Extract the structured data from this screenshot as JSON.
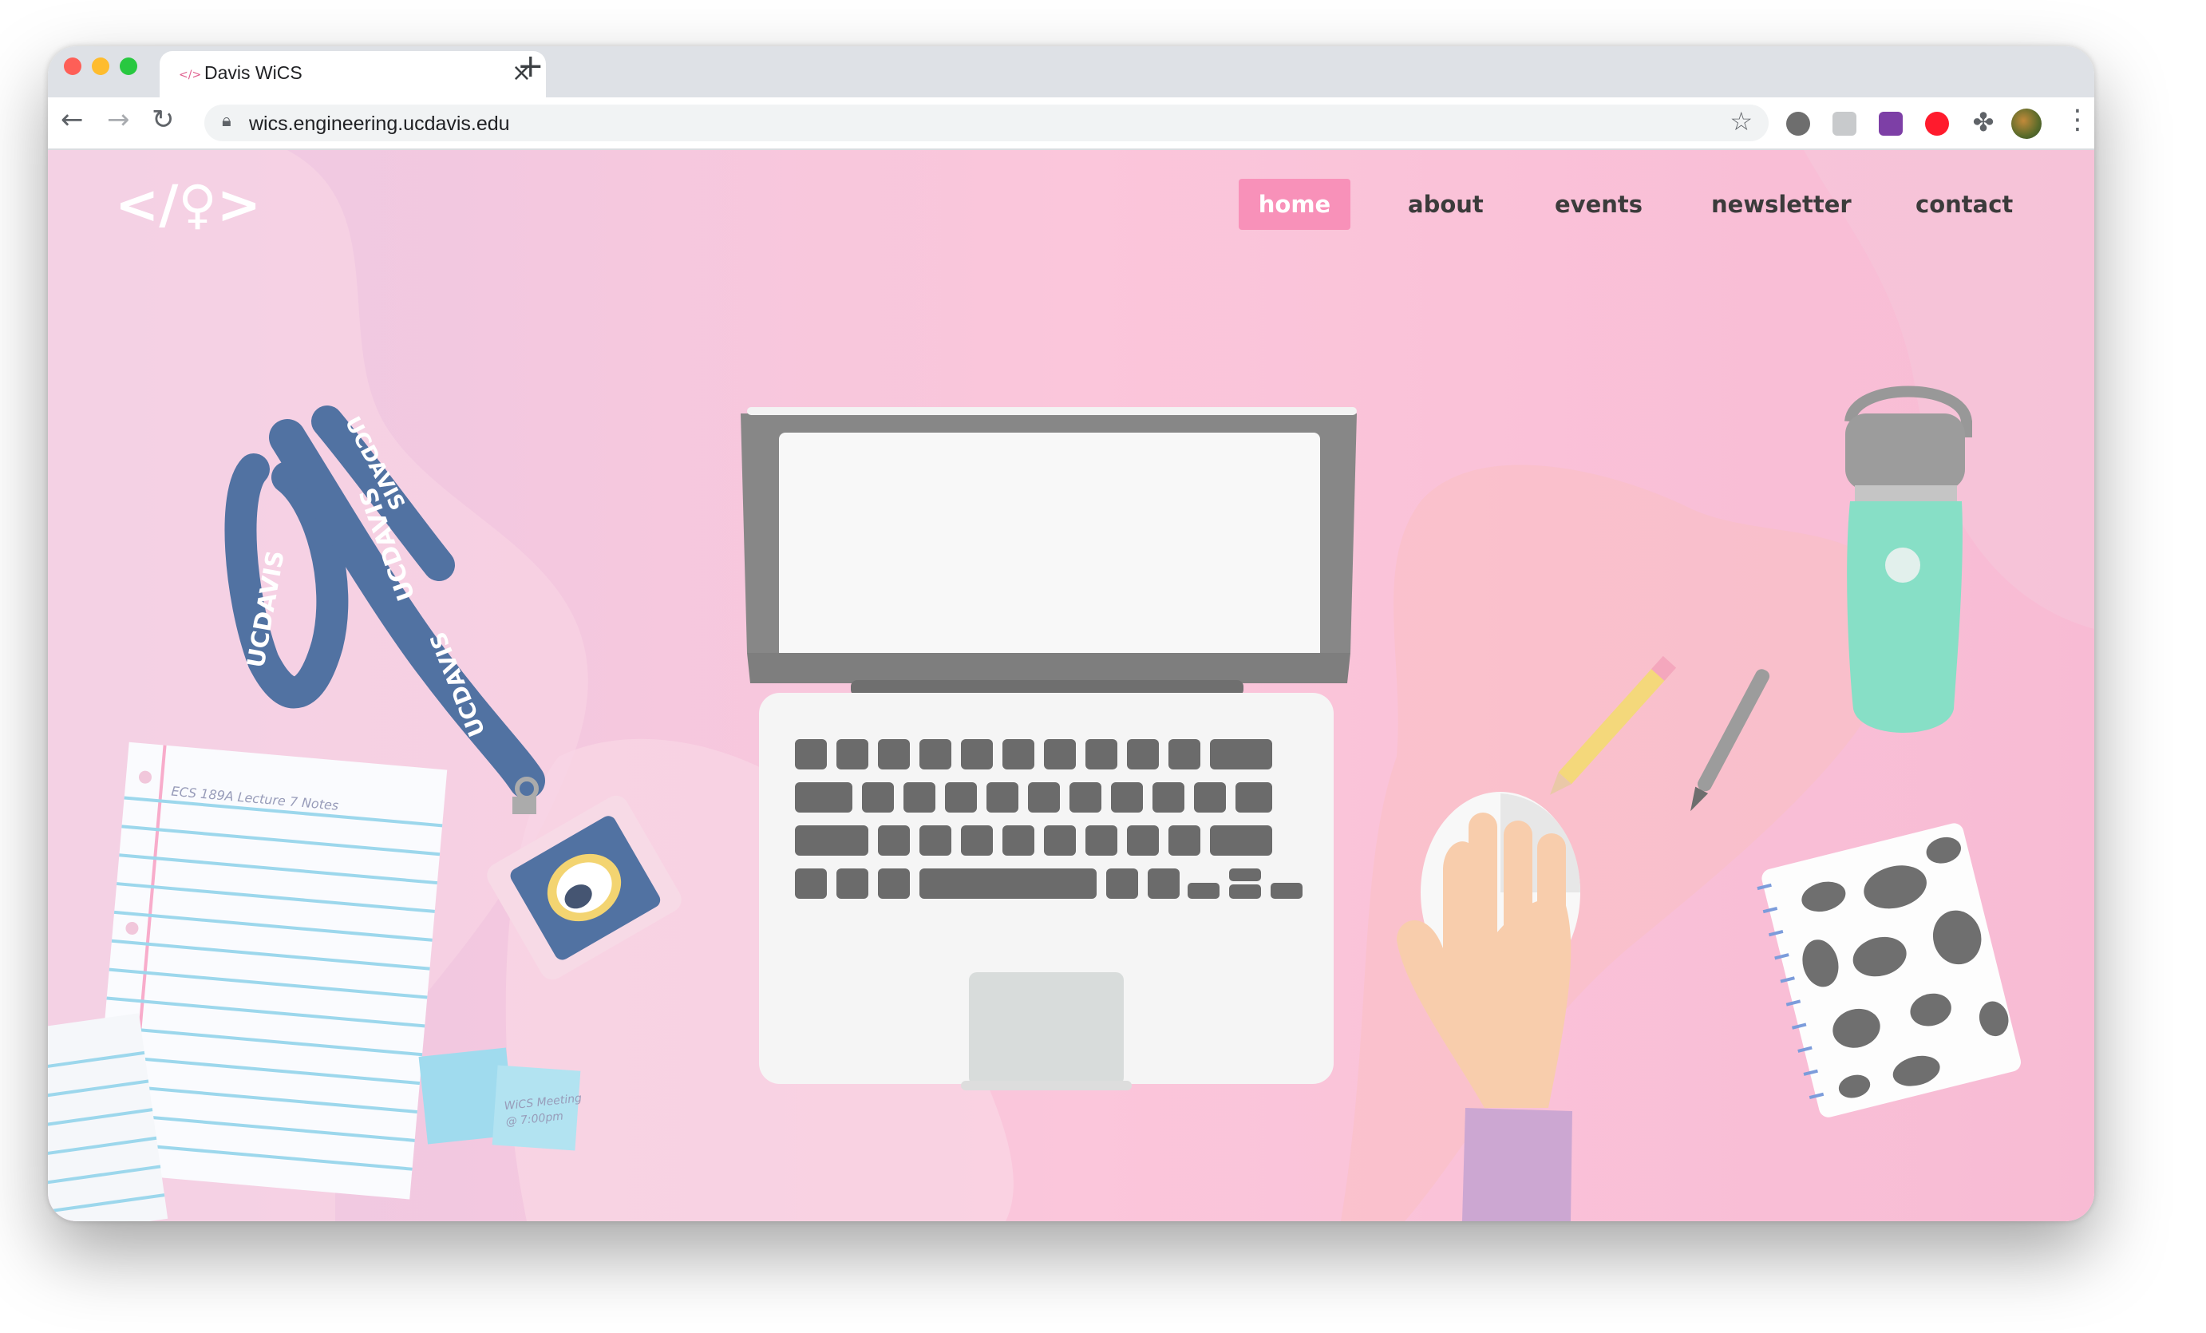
{
  "browser": {
    "tab_title": "Davis WiCS",
    "tab_favicon": "</>",
    "url": "wics.engineering.ucdavis.edu",
    "icons": [
      "back-arrow-icon",
      "forward-arrow-icon",
      "reload-icon",
      "lock-icon",
      "bookmark-star-icon",
      "extension-icon",
      "profile-avatar",
      "kebab-menu-icon"
    ]
  },
  "site": {
    "logo": "</♀>",
    "nav": {
      "home": "home",
      "about": "about",
      "events": "events",
      "newsletter": "newsletter",
      "contact": "contact"
    },
    "illustration": {
      "lanyard_text": [
        "UCDAVIS",
        "UCDAVIS",
        "UCDAVIS",
        "UCDAVIS"
      ],
      "notebook_title": "ECS 189A Lecture 7 Notes",
      "sticky_note": [
        "WiCS Meeting",
        "@ 7:00pm"
      ]
    },
    "colors": {
      "accent": "#f891b9",
      "background_pink": "#f9c6d9",
      "laptop_gray": "#777777",
      "bottle_mint": "#77dbbf"
    }
  }
}
